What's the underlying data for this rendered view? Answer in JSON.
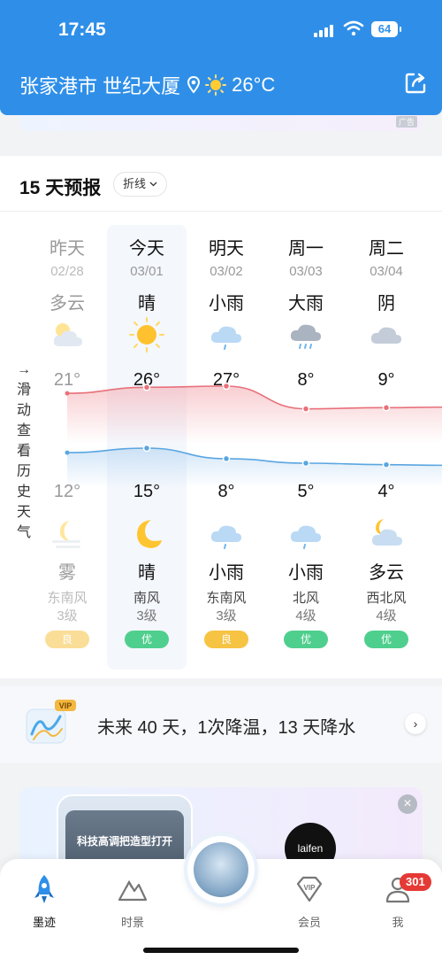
{
  "status": {
    "time": "17:45",
    "battery": "64"
  },
  "header": {
    "city": "张家港市 世纪大厦",
    "temp": "26°C"
  },
  "forecast": {
    "title": "15 天预报",
    "mode_label": "折线",
    "side_hint": "→ 滑动查看历史天气",
    "days": [
      {
        "name": "昨天",
        "date": "02/28",
        "cond": "多云",
        "high": "21°",
        "low": "12°",
        "night": "雾",
        "wind": "东南风",
        "level": "3级",
        "aqi": "良"
      },
      {
        "name": "今天",
        "date": "03/01",
        "cond": "晴",
        "high": "26°",
        "low": "15°",
        "night": "晴",
        "wind": "南风",
        "level": "3级",
        "aqi": "优"
      },
      {
        "name": "明天",
        "date": "03/02",
        "cond": "小雨",
        "high": "27°",
        "low": "8°",
        "night": "小雨",
        "wind": "东南风",
        "level": "3级",
        "aqi": "良"
      },
      {
        "name": "周一",
        "date": "03/03",
        "cond": "大雨",
        "high": "8°",
        "low": "5°",
        "night": "小雨",
        "wind": "北风",
        "level": "4级",
        "aqi": "优"
      },
      {
        "name": "周二",
        "date": "03/04",
        "cond": "阴",
        "high": "9°",
        "low": "4°",
        "night": "多云",
        "wind": "西北风",
        "level": "4级",
        "aqi": "优"
      }
    ],
    "highs": [
      21,
      26,
      27,
      8,
      9
    ],
    "lows": [
      12,
      15,
      8,
      5,
      4
    ]
  },
  "long_range": {
    "vip": "VIP",
    "text": "未来 40 天，1次降温，13 天降水"
  },
  "ads": {
    "top_tag": "广告",
    "card_text": "科技高调把造型打开",
    "brand": "laifen"
  },
  "tabs": [
    {
      "label": "墨迹"
    },
    {
      "label": "时景"
    },
    {
      "label": "会员"
    },
    {
      "label": "我"
    }
  ],
  "badge": "301",
  "colors": {
    "header": "#2f8fe8",
    "high_line": "#e8707a",
    "low_line": "#5aa6e0",
    "aqi_good": "#f6c343",
    "aqi_excellent": "#4fcf8e"
  }
}
